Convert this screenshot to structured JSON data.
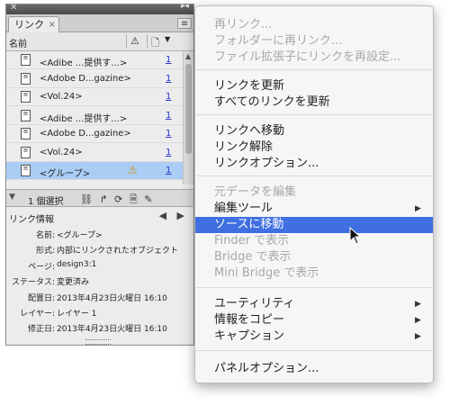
{
  "panel": {
    "close_glyph": "✕",
    "grip_glyph": "▸◂",
    "tab_label": "リンク",
    "tab_close_glyph": "×",
    "menu_glyph": "≡",
    "column_name": "名前",
    "column_warning_glyph": "⚠",
    "column_page_glyph": "🗋",
    "sort_glyph": "▼",
    "rows": [
      {
        "label": "<Adibe ...提供す...>",
        "page": "1"
      },
      {
        "label": "<Adobe D...gazine>",
        "page": "1"
      },
      {
        "label": "<Vol.24>",
        "page": "1"
      },
      {
        "label": "<Adibe ...提供す...>",
        "page": "1"
      },
      {
        "label": "<Adobe D...gazine>",
        "page": "1"
      },
      {
        "label": "<Vol.24>",
        "page": "1"
      },
      {
        "label": "<グループ>",
        "page": "1",
        "selected": true,
        "warning": true
      }
    ],
    "selected_count": "1 個選択",
    "status_tools_glyphs": "⛓ ↱ ⟳ 🗎 ✎",
    "link_info_title": "リンク情報",
    "link_info_nav": "◀ ▶",
    "info": [
      {
        "key": "名前:",
        "value": "<グループ>"
      },
      {
        "key": "形式:",
        "value": "内部にリンクされたオブジェクト"
      },
      {
        "key": "ページ:",
        "value": "design3:1"
      },
      {
        "key": "ステータス:",
        "value": "変更済み"
      },
      {
        "key": "配置日:",
        "value": "2013年4月23日火曜日 16:10"
      },
      {
        "key": "レイヤー:",
        "value": "レイヤー 1"
      },
      {
        "key": "修正日:",
        "value": "2013年4月23日火曜日 16:10"
      }
    ]
  },
  "menu": {
    "items": [
      {
        "label": "再リンク...",
        "disabled": true
      },
      {
        "label": "フォルダーに再リンク...",
        "disabled": true
      },
      {
        "label": "ファイル拡張子にリンクを再設定...",
        "disabled": true
      },
      {
        "label": "リンクを更新",
        "disabled": false
      },
      {
        "label": "すべてのリンクを更新",
        "disabled": false
      },
      {
        "label": "リンクへ移動",
        "disabled": false
      },
      {
        "label": "リンク解除",
        "disabled": false
      },
      {
        "label": "リンクオプション...",
        "disabled": false
      },
      {
        "label": "元データを編集",
        "disabled": true
      },
      {
        "label": "編集ツール",
        "disabled": false,
        "submenu": true
      },
      {
        "label": "ソースに移動",
        "disabled": false,
        "highlighted": true
      },
      {
        "label": "Finder で表示",
        "disabled": true
      },
      {
        "label": "Bridge で表示",
        "disabled": true
      },
      {
        "label": "Mini Bridge で表示",
        "disabled": true
      },
      {
        "label": "ユーティリティ",
        "disabled": false,
        "submenu": true
      },
      {
        "label": "情報をコピー",
        "disabled": false,
        "submenu": true
      },
      {
        "label": "キャプション",
        "disabled": false,
        "submenu": true
      },
      {
        "label": "パネルオプション...",
        "disabled": false
      }
    ],
    "submenu_glyph": "▶"
  },
  "colors": {
    "highlight": "#3f6fe0",
    "selected_row": "#a9cdf5",
    "warning": "#d89000",
    "link_number": "#2233cc"
  }
}
